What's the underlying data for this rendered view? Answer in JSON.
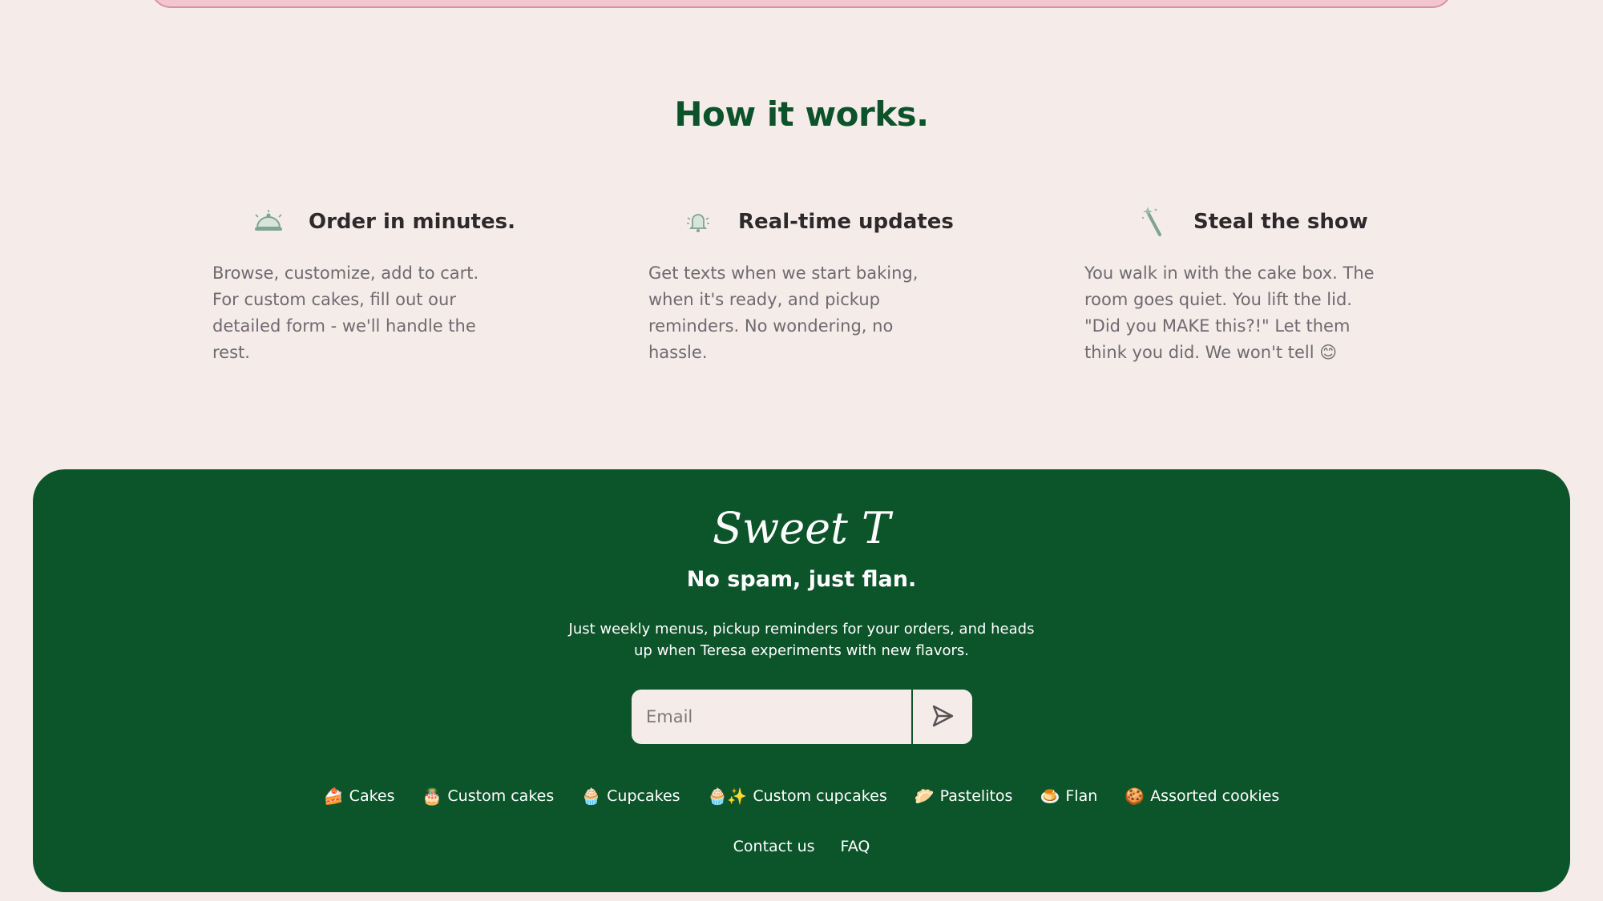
{
  "how": {
    "title": "How it works.",
    "features": [
      {
        "icon": "serving-cloche-icon",
        "title": "Order in minutes.",
        "text": "Browse, customize, add to cart. For custom cakes, fill out our detailed form - we'll handle the rest."
      },
      {
        "icon": "bell-ringing-icon",
        "title": "Real-time updates",
        "text": "Get texts when we start baking, when it's ready, and pickup reminders. No wondering, no hassle."
      },
      {
        "icon": "magic-wand-icon",
        "title": "Steal the show",
        "text": "You walk in with the cake box. The room goes quiet. You lift the lid. \"Did you MAKE this?!\" Let them think you did. We won't tell 😊"
      }
    ]
  },
  "footer": {
    "logo": "Sweet T",
    "tagline": "No spam, just flan.",
    "subtitle": "Just weekly menus, pickup reminders for your orders, and heads up when Teresa experiments with new flavors.",
    "email_placeholder": "Email",
    "links": [
      {
        "emoji": "🍰",
        "label": "Cakes"
      },
      {
        "emoji": "🎂",
        "label": "Custom cakes"
      },
      {
        "emoji": "🧁",
        "label": "Cupcakes"
      },
      {
        "emoji": "🧁✨",
        "label": "Custom cupcakes"
      },
      {
        "emoji": "🥟",
        "label": "Pastelitos"
      },
      {
        "emoji": "🍮",
        "label": "Flan"
      },
      {
        "emoji": "🍪",
        "label": "Assorted cookies"
      }
    ],
    "bottom_links": [
      "Contact us",
      "FAQ"
    ]
  },
  "colors": {
    "background": "#f5ece9",
    "brand_green": "#0c552b",
    "heading_green": "#0c522a",
    "pink_accent": "#f1c6cf"
  }
}
